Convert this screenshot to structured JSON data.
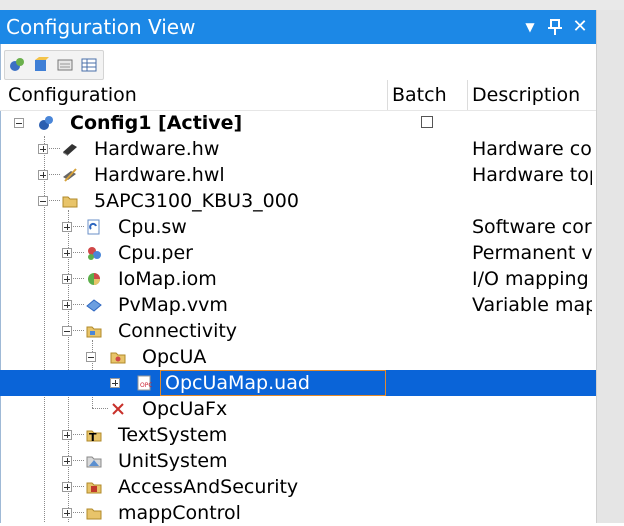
{
  "window": {
    "title": "Configuration View"
  },
  "titlebar": {
    "menu_glyph": "▼",
    "pin_glyph": "⊤",
    "close_glyph": "✕"
  },
  "columns": {
    "configuration": "Configuration",
    "batch": "Batch",
    "description": "Description"
  },
  "tree": [
    {
      "label": "Config1 [Active]",
      "bold": true,
      "icon": "config-icon",
      "desc": ""
    },
    {
      "label": "Hardware.hw",
      "icon": "hardware-icon",
      "desc": "Hardware co"
    },
    {
      "label": "Hardware.hwl",
      "icon": "hardware-topology-icon",
      "desc": "Hardware top"
    },
    {
      "label": "5APC3100_KBU3_000",
      "icon": "folder-icon",
      "desc": ""
    },
    {
      "label": "Cpu.sw",
      "icon": "software-icon",
      "desc": "Software cor"
    },
    {
      "label": "Cpu.per",
      "icon": "permanent-variables-icon",
      "desc": "Permanent v"
    },
    {
      "label": "IoMap.iom",
      "icon": "io-mapping-icon",
      "desc": "I/O mapping"
    },
    {
      "label": "PvMap.vvm",
      "icon": "variable-mapping-icon",
      "desc": "Variable map"
    },
    {
      "label": "Connectivity",
      "icon": "folder-icon",
      "desc": ""
    },
    {
      "label": "OpcUA",
      "icon": "folder-icon",
      "desc": ""
    },
    {
      "label": "OpcUaMap.uad",
      "icon": "opcua-map-icon",
      "desc": ""
    },
    {
      "label": "OpcUaFx",
      "icon": "error-x-icon",
      "desc": ""
    },
    {
      "label": "TextSystem",
      "icon": "text-system-icon",
      "desc": ""
    },
    {
      "label": "UnitSystem",
      "icon": "unit-system-icon",
      "desc": ""
    },
    {
      "label": "AccessAndSecurity",
      "icon": "security-folder-icon",
      "desc": ""
    },
    {
      "label": "mappControl",
      "icon": "folder-icon",
      "desc": ""
    }
  ],
  "colors": {
    "titlebar": "#1c88e6",
    "selection": "#0a64d8",
    "edit_border": "#e08a2e"
  }
}
